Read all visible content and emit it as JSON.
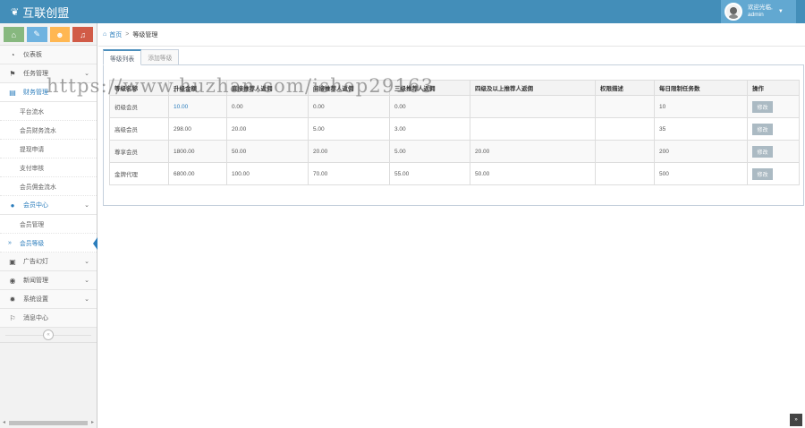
{
  "brand": {
    "name": "互联创盟"
  },
  "user": {
    "welcome": "欢迎光临,",
    "name": "admin"
  },
  "shortcuts": [
    {
      "icon": "home-icon",
      "color": "#87b87f"
    },
    {
      "icon": "pencil-icon",
      "color": "#6fb3e0"
    },
    {
      "icon": "group-icon",
      "color": "#ffb752"
    },
    {
      "icon": "bell-icon",
      "color": "#d15b47"
    }
  ],
  "sidebar": {
    "items": [
      {
        "label": "仪表板"
      },
      {
        "label": "任务管理"
      },
      {
        "label": "财务管理"
      },
      {
        "label": "平台流水"
      },
      {
        "label": "会员财务流水"
      },
      {
        "label": "提现申请"
      },
      {
        "label": "支付审核"
      },
      {
        "label": "会员佣金流水"
      },
      {
        "label": "会员中心"
      },
      {
        "label": "会员管理"
      },
      {
        "label": "会员等级"
      },
      {
        "label": "广告幻灯"
      },
      {
        "label": "新闻管理"
      },
      {
        "label": "系统设置"
      },
      {
        "label": "消息中心"
      }
    ]
  },
  "breadcrumb": {
    "home": "首页",
    "separator": ">",
    "current": "等级管理"
  },
  "tabs": [
    {
      "label": "等级列表"
    },
    {
      "label": "添加等级"
    }
  ],
  "table": {
    "headers": [
      "等级名称",
      "升级金额",
      "直接推荐人返佣",
      "间接推荐人返佣",
      "三级推荐人返佣",
      "四级及以上推荐人返佣",
      "权限描述",
      "每日限制任务数",
      "操作"
    ],
    "rows": [
      [
        "初级会员",
        "10.00",
        "0.00",
        "0.00",
        "0.00",
        "",
        "",
        "10",
        "修改"
      ],
      [
        "高级会员",
        "298.00",
        "20.00",
        "5.00",
        "3.00",
        "",
        "",
        "35",
        "修改"
      ],
      [
        "尊享会员",
        "1800.00",
        "50.00",
        "20.00",
        "5.00",
        "20.00",
        "",
        "200",
        "修改"
      ],
      [
        "金牌代理",
        "6800.00",
        "100.00",
        "70.00",
        "55.00",
        "50.00",
        "",
        "500",
        "修改"
      ]
    ]
  },
  "watermark": "https://www.huzhan.com/ishop29163",
  "colors": {
    "navbar": "#438eb9",
    "accent": "#2b7dbc",
    "edit_button": "#abbac3"
  }
}
